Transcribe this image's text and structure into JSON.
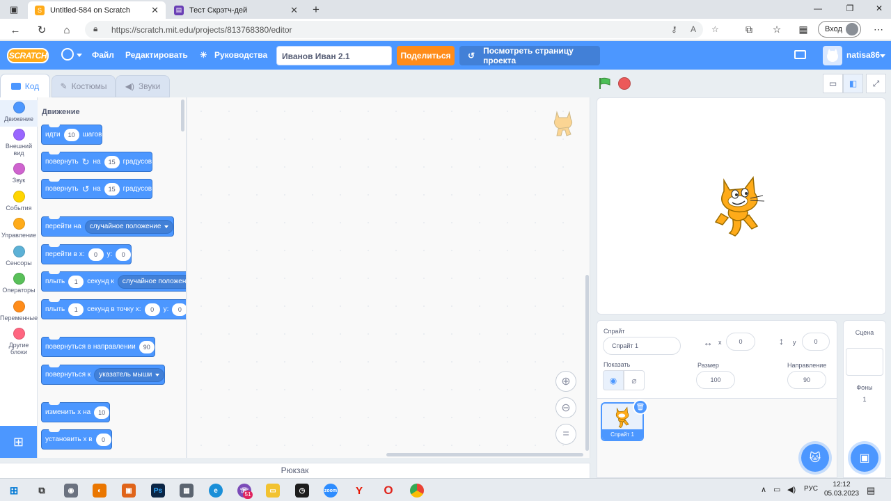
{
  "browser": {
    "tabs": [
      {
        "title": "Untitled-584 on Scratch",
        "active": true
      },
      {
        "title": "Тест Скрэтч-дей",
        "active": false
      }
    ],
    "url": "https://scratch.mit.edu/projects/813768380/editor",
    "signin_label": "Вход"
  },
  "menu": {
    "logo": "SCRATCH",
    "file": "Файл",
    "edit": "Редактировать",
    "tutorials": "Руководства",
    "project_title": "Иванов Иван 2.1",
    "share": "Поделиться",
    "see_project": "Посмотреть страницу проекта",
    "username": "natisa86"
  },
  "editor_tabs": {
    "code": "Код",
    "costumes": "Костюмы",
    "sounds": "Звуки"
  },
  "categories": [
    {
      "label": "Движение",
      "color": "#4c97ff"
    },
    {
      "label": "Внешний вид",
      "color": "#9966ff"
    },
    {
      "label": "Звук",
      "color": "#cf63cf"
    },
    {
      "label": "События",
      "color": "#ffd500"
    },
    {
      "label": "Управление",
      "color": "#ffab19"
    },
    {
      "label": "Сенсоры",
      "color": "#5cb1d6"
    },
    {
      "label": "Операторы",
      "color": "#59c059"
    },
    {
      "label": "Переменные",
      "color": "#ff8c1a"
    },
    {
      "label": "Другие блоки",
      "color": "#ff6680"
    }
  ],
  "palette": {
    "title": "Движение",
    "move": {
      "a": "идти",
      "v": "10",
      "b": "шагов"
    },
    "turn_right": {
      "a": "повернуть",
      "b": "на",
      "v": "15",
      "c": "градусов"
    },
    "turn_left": {
      "a": "повернуть",
      "b": "на",
      "v": "15",
      "c": "градусов"
    },
    "goto": {
      "a": "перейти на",
      "d": "случайное положение"
    },
    "goto_xy": {
      "a": "перейти в x:",
      "x": "0",
      "b": "y:",
      "y": "0"
    },
    "glide": {
      "a": "плыть",
      "v": "1",
      "b": "секунд к",
      "d": "случайное положение"
    },
    "glide_xy": {
      "a": "плыть",
      "v": "1",
      "b": "секунд в точку x:",
      "x": "0",
      "c": "y:",
      "y": "0"
    },
    "point_dir": {
      "a": "повернуться в направлении",
      "v": "90"
    },
    "point_towards": {
      "a": "повернуться к",
      "d": "указатель мыши"
    },
    "change_x": {
      "a": "изменить х на",
      "v": "10"
    },
    "set_x": {
      "a": "установить х в",
      "v": "0"
    }
  },
  "backpack": "Рюкзак",
  "sprite_info": {
    "sprite_label": "Спрайт",
    "sprite_name": "Спрайт 1",
    "x_label": "x",
    "x_value": "0",
    "y_label": "y",
    "y_value": "0",
    "show_label": "Показать",
    "size_label": "Размер",
    "size_value": "100",
    "direction_label": "Направление",
    "direction_value": "90",
    "sprite_card_name": "Спрайт 1"
  },
  "scene": {
    "label": "Сцена",
    "backdrops_label": "Фоны",
    "backdrops_count": "1"
  },
  "taskbar": {
    "badge": "51",
    "lang": "РУС",
    "time": "12:12",
    "date": "05.03.2023"
  }
}
